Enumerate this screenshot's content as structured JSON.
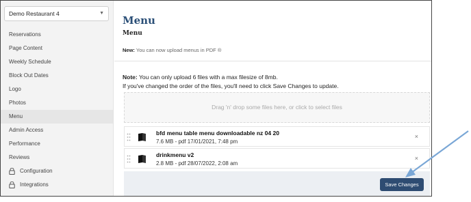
{
  "sidebar": {
    "restaurant": "Demo Restaurant 4",
    "items": [
      {
        "label": "Reservations",
        "locked": false,
        "active": false
      },
      {
        "label": "Page Content",
        "locked": false,
        "active": false
      },
      {
        "label": "Weekly Schedule",
        "locked": false,
        "active": false
      },
      {
        "label": "Block Out Dates",
        "locked": false,
        "active": false
      },
      {
        "label": "Logo",
        "locked": false,
        "active": false
      },
      {
        "label": "Photos",
        "locked": false,
        "active": false
      },
      {
        "label": "Menu",
        "locked": false,
        "active": true
      },
      {
        "label": "Admin Access",
        "locked": false,
        "active": false
      },
      {
        "label": "Performance",
        "locked": false,
        "active": false
      },
      {
        "label": "Reviews",
        "locked": false,
        "active": false
      },
      {
        "label": "Configuration",
        "locked": true,
        "active": false
      },
      {
        "label": "Integrations",
        "locked": true,
        "active": false
      }
    ]
  },
  "main": {
    "title": "Menu",
    "subtitle": "Menu",
    "new_label": "New:",
    "new_text": "You can now upload menus in PDF ®",
    "note_label": "Note:",
    "note_text": "You can only upload 6 files with a max filesize of 8mb.",
    "note_line2": "If you've changed the order of the files, you'll need to click Save Changes to update.",
    "dropzone_text": "Drag 'n' drop some files here, or click to select files",
    "files": [
      {
        "name": "bfd menu table menu downloadable nz 04 20",
        "meta": "7.6 MB - pdf 17/01/2021, 7:48 pm"
      },
      {
        "name": "drinkmenu v2",
        "meta": "2.8 MB - pdf 28/07/2022, 2:08 am"
      }
    ],
    "remove_symbol": "×",
    "save_label": "Save Changes"
  },
  "colors": {
    "accent": "#2e4c72",
    "title": "#2b4f77",
    "arrow": "#7aa7d6"
  }
}
